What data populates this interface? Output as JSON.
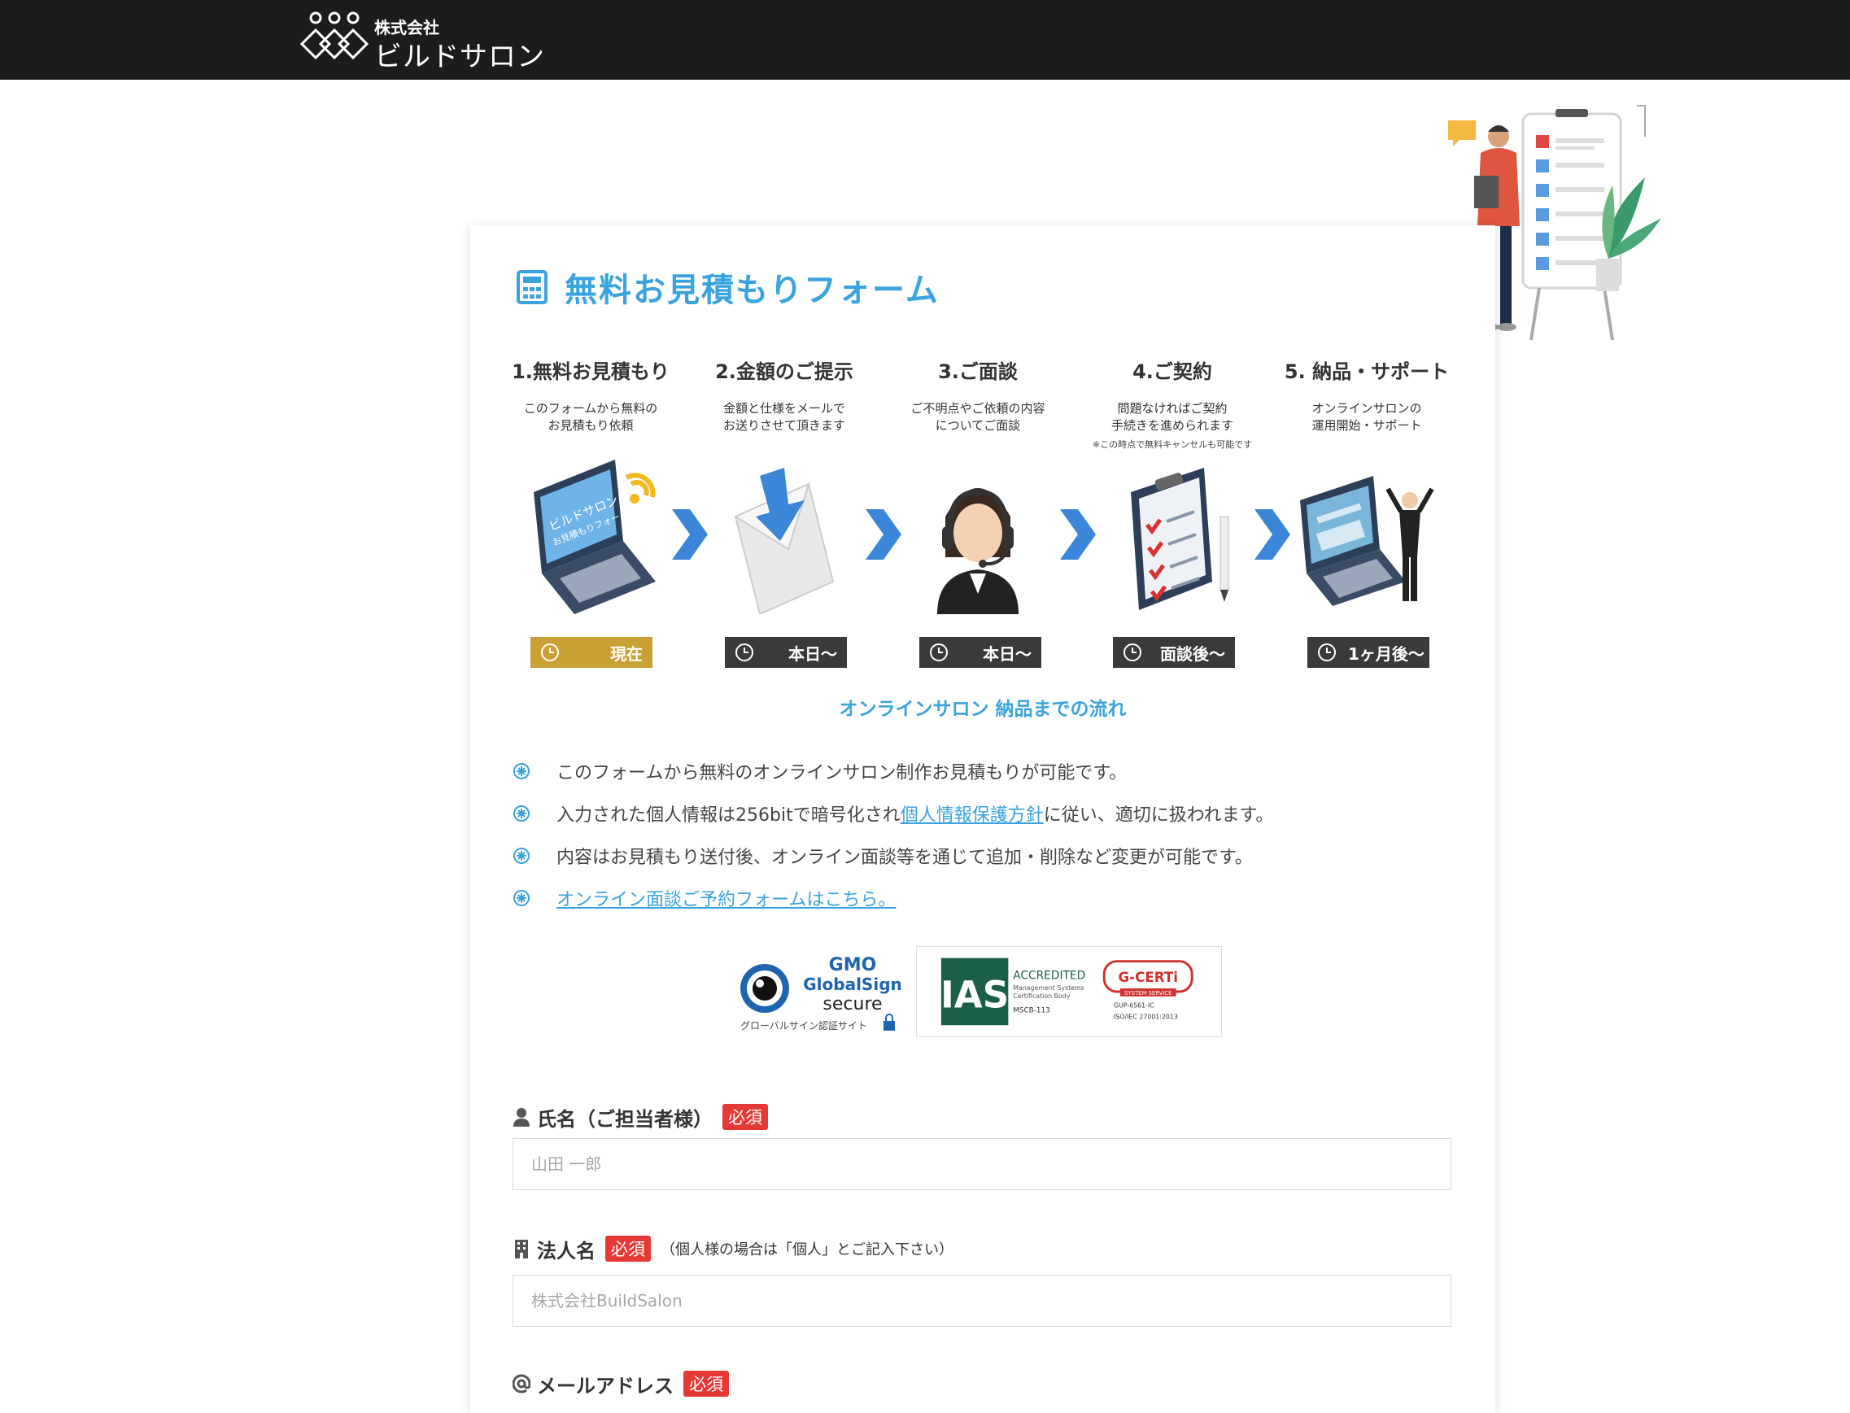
{
  "header": {
    "logo_sub": "株式会社",
    "logo_main": "ビルドサロン"
  },
  "form": {
    "title": "無料お見積もりフォーム"
  },
  "steps": [
    {
      "title": "1.無料お見積もり",
      "desc": "このフォームから無料の\nお見積もり依頼",
      "note": "",
      "badge": "現在",
      "badge_color": "#c9a033"
    },
    {
      "title": "2.金額のご提示",
      "desc": "金額と仕様をメールで\nお送りさせて頂きます",
      "note": "",
      "badge": "本日〜",
      "badge_color": "#3a3a3a"
    },
    {
      "title": "3.ご面談",
      "desc": "ご不明点やご依頼の内容\nについてご面談",
      "note": "",
      "badge": "本日〜",
      "badge_color": "#3a3a3a"
    },
    {
      "title": "4.ご契約",
      "desc": "問題なければご契約\n手続きを進められます",
      "note": "※この時点で無料キャンセルも可能です",
      "badge": "面談後〜",
      "badge_color": "#3a3a3a"
    },
    {
      "title": "5. 納品・サポート",
      "desc": "オンラインサロンの\n運用開始・サポート",
      "note": "",
      "badge": "1ヶ月後〜",
      "badge_color": "#3a3a3a"
    }
  ],
  "illustration": {
    "laptop_line1": "ビルドサロン",
    "laptop_line2": "お見積もりフォーム"
  },
  "flow_caption": "オンラインサロン 納品までの流れ",
  "notes": {
    "n1": "このフォームから無料のオンラインサロン制作お見積もりが可能です。",
    "n2_pre": "入力された個人情報は256bitで暗号化され",
    "n2_link": "個人情報保護方針",
    "n2_post": "に従い、適切に扱われます。",
    "n3": "内容はお見積もり送付後、オンライン面談等を通じて追加・削除など変更が可能です。",
    "n4_link": "オンライン面談ご予約フォームはこちら。"
  },
  "seals": {
    "gmo_brand": "GMO",
    "gmo_name": "GlobalSign",
    "gmo_secure": "secure",
    "gmo_caption": "グローバルサイン認証サイト",
    "ias_logo": "IAS",
    "ias_accredited": "ACCREDITED",
    "ias_line1": "Management Systems",
    "ias_line2": "Certification Body",
    "ias_code": "MSCB-113",
    "gcert_name": "G-CERTi",
    "gcert_tag": "SYSTEM SERVICE",
    "gcert_code": "GUP-6561-IC",
    "gcert_iso": "ISO/IEC 27001:2013"
  },
  "fields": {
    "name": {
      "label": "氏名（ご担当者様）",
      "required": "必須",
      "placeholder": "山田 一郎"
    },
    "company": {
      "label": "法人名",
      "required": "必須",
      "hint": "（個人様の場合は「個人」とご記入下さい）",
      "placeholder": "株式会社BuildSalon"
    },
    "email": {
      "label": "メールアドレス",
      "required": "必須"
    }
  }
}
